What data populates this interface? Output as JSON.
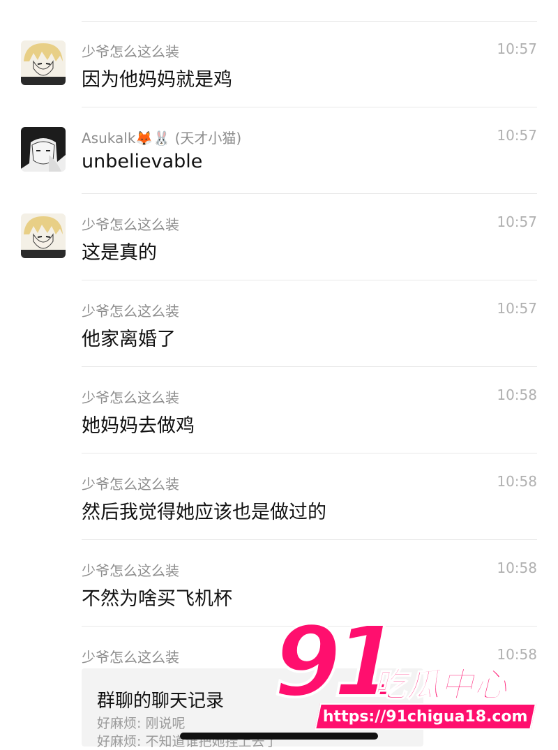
{
  "messages": [
    {
      "sender": "少爷怎么这么装",
      "time": "10:57",
      "text": "因为他妈妈就是鸡",
      "avatar": "blonde-anime-avatar"
    },
    {
      "sender": "Asukalk🦊🐰 (天才小猫)",
      "time": "10:57",
      "text": "unbelievable",
      "avatar": "dark-haired-anime-avatar"
    },
    {
      "sender": "少爷怎么这么装",
      "time": "10:57",
      "text": "这是真的",
      "avatar": "blonde-anime-avatar"
    },
    {
      "sender": "少爷怎么这么装",
      "time": "10:57",
      "text": "他家离婚了"
    },
    {
      "sender": "少爷怎么这么装",
      "time": "10:58",
      "text": "她妈妈去做鸡"
    },
    {
      "sender": "少爷怎么这么装",
      "time": "10:58",
      "text": "然后我觉得她应该也是做过的"
    },
    {
      "sender": "少爷怎么这么装",
      "time": "10:58",
      "text": "不然为啥买飞机杯"
    },
    {
      "sender": "少爷怎么这么装",
      "time": "10:58"
    }
  ],
  "chat_record_card": {
    "title": "群聊的聊天记录",
    "lines": [
      "好麻烦: 刚说呢",
      "好麻烦: 不知道谁把她挂上去了"
    ]
  },
  "watermark": {
    "number": "91",
    "text": "吃瓜中心",
    "url": "https://91chigua18.com"
  },
  "colors": {
    "accent": "#ff0f6e",
    "sender": "#8d8d8d",
    "time": "#b0b0b0"
  }
}
